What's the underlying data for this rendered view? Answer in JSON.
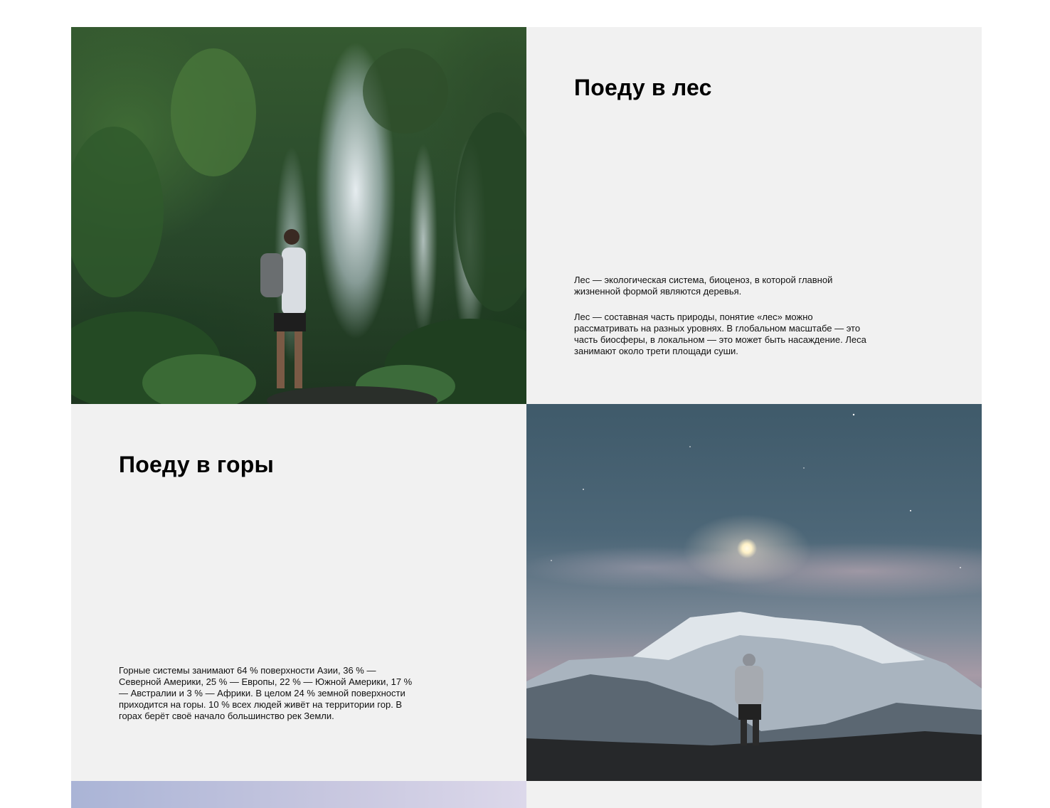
{
  "sections": {
    "forest": {
      "title": "Поеду в лес",
      "paragraphs": [
        "Лес — экологическая система, биоценоз, в которой главной жизненной формой являются деревья.",
        "Лес — составная часть природы, понятие «лес» можно рассматривать на разных уровнях. В глобальном масштабе — это часть биосферы, в локальном — это может быть насаждение. Леса занимают около трети площади суши."
      ]
    },
    "mountains": {
      "title": "Поеду в горы",
      "paragraphs": [
        "Горные системы занимают 64 % поверхности Азии, 36 % — Северной Америки, 25 % — Европы, 22 % — Южной Америки, 17 % — Австралии и 3 % — Африки. В целом 24 % земной поверхности приходится на горы. 10 % всех людей живёт на территории гор. В горах берёт своё начало большинство рек Земли."
      ]
    }
  },
  "colors": {
    "panel_background": "#f1f1f1",
    "page_background": "#ffffff",
    "heading_text": "#000000"
  }
}
